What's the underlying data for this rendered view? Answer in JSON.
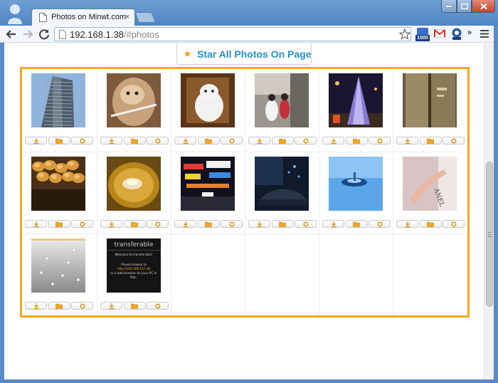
{
  "browser": {
    "tab_title": "Photos on Minwt.com",
    "tab_close": "×",
    "url_host": "192.168.1.38",
    "url_path": "/#photos",
    "extension_badge_count": "1000",
    "overflow_label": "»"
  },
  "page": {
    "star_all_label": "Star All Photos On Page",
    "accent_color": "#f5a623",
    "link_color": "#2a8fc7"
  },
  "photos": [
    {
      "subject": "office-tower",
      "actions": [
        "download-icon",
        "folder-icon",
        "circle-icon"
      ]
    },
    {
      "subject": "cat-in-glass",
      "actions": [
        "download-icon",
        "folder-icon",
        "circle-icon"
      ]
    },
    {
      "subject": "white-cat",
      "actions": [
        "download-icon",
        "folder-icon",
        "circle-icon"
      ]
    },
    {
      "subject": "couple-street",
      "actions": [
        "download-icon",
        "folder-icon",
        "circle-icon"
      ]
    },
    {
      "subject": "christmas-tree",
      "actions": [
        "download-icon",
        "folder-icon",
        "circle-icon"
      ]
    },
    {
      "subject": "glass-door",
      "actions": [
        "download-icon",
        "folder-icon",
        "circle-icon"
      ]
    },
    {
      "subject": "pastries",
      "actions": [
        "download-icon",
        "folder-icon",
        "circle-icon"
      ]
    },
    {
      "subject": "dumpling-soup",
      "actions": [
        "download-icon",
        "folder-icon",
        "circle-icon"
      ]
    },
    {
      "subject": "night-street-signs",
      "actions": [
        "download-icon",
        "folder-icon",
        "circle-icon"
      ]
    },
    {
      "subject": "night-car",
      "actions": [
        "download-icon",
        "folder-icon",
        "circle-icon"
      ]
    },
    {
      "subject": "water-drop",
      "actions": [
        "download-icon",
        "folder-icon",
        "circle-icon"
      ]
    },
    {
      "subject": "chanel-bag-hand",
      "actions": [
        "download-icon",
        "folder-icon",
        "circle-icon"
      ]
    },
    {
      "subject": "rain-on-glass",
      "actions": [
        "download-icon",
        "folder-icon",
        "circle-icon"
      ]
    },
    {
      "subject": "phone-screenshot",
      "screen_lines": [
        "transferable",
        "Welcome to transferable!",
        "Please browse to",
        "http://192.168.137.38",
        "in a web browser on your PC or",
        "Mac."
      ],
      "actions": [
        "download-icon",
        "folder-icon",
        "circle-icon"
      ]
    }
  ]
}
